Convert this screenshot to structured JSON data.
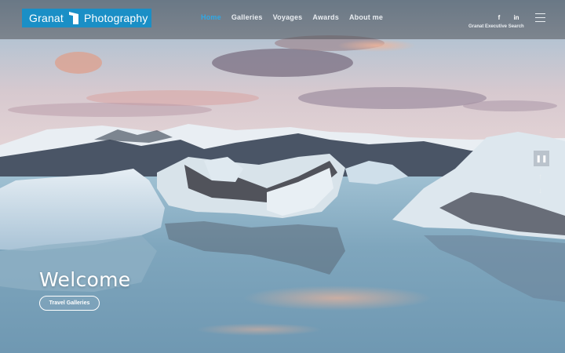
{
  "header": {
    "logo": {
      "word1": "Granat",
      "word2": "Photography",
      "brand_color": "#1a8fc6"
    },
    "nav": [
      {
        "label": "Home",
        "active": true
      },
      {
        "label": "Galleries",
        "active": false
      },
      {
        "label": "Voyages",
        "active": false
      },
      {
        "label": "Awards",
        "active": false
      },
      {
        "label": "About me",
        "active": false
      }
    ],
    "social": [
      {
        "icon": "facebook-icon",
        "glyph": "f"
      },
      {
        "icon": "linkedin-icon",
        "glyph": "in"
      }
    ],
    "tagline": "Granat Executive Search",
    "menu_icon": "hamburger-icon"
  },
  "slider": {
    "pause_glyph": "❚❚",
    "up_glyph": "↑",
    "down_glyph": "↓"
  },
  "hero": {
    "title": "Welcome",
    "cta_label": "Travel Galleries"
  }
}
